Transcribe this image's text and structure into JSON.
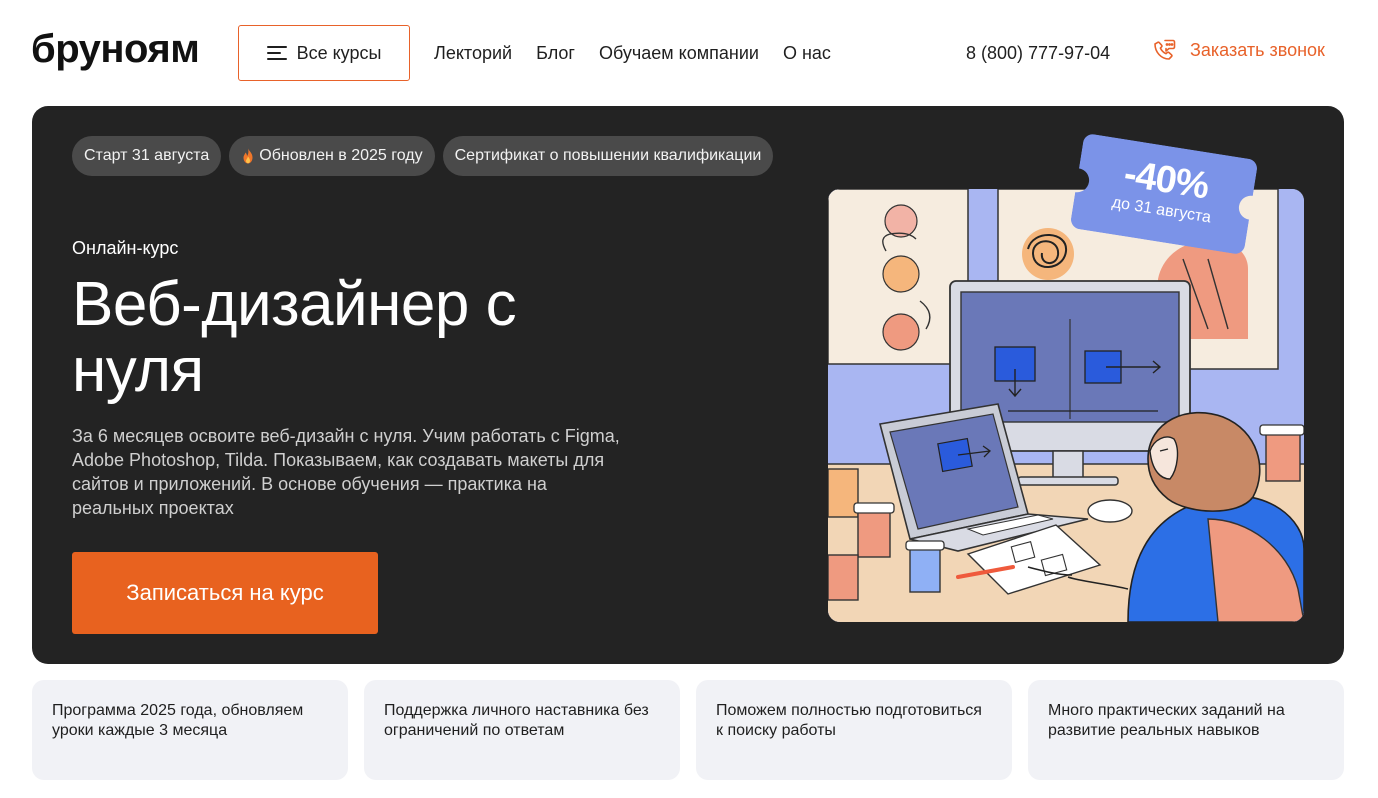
{
  "header": {
    "logo": "бруноям",
    "all_courses_label": "Все курсы",
    "nav": [
      "Лекторий",
      "Блог",
      "Обучаем компании",
      "О нас"
    ],
    "phone": "8 (800) 777-97-04",
    "callback_label": "Заказать звонок"
  },
  "hero": {
    "chips": [
      "Старт 31 августа",
      "Обновлен в 2025 году",
      "Сертификат о повышении квалификации"
    ],
    "kicker": "Онлайн-курс",
    "title": "Веб-дизайнер с нуля",
    "description": "За 6 месяцев освоите веб-дизайн с нуля. Учим работать с Figma, Adobe Photoshop, Tilda. Показываем, как создавать макеты для сайтов и приложений. В основе обучения — практика на реальных проектах",
    "cta_label": "Записаться на курс",
    "discount": {
      "value": "-40%",
      "until": "до 31 августа"
    }
  },
  "features": [
    "Программа 2025 года, обновляем уроки каждые 3 месяца",
    "Поддержка личного наставника без ограничений по ответам",
    "Поможем полностью подготовиться к поиску работы",
    "Много практических заданий на развитие реальных навыков"
  ],
  "colors": {
    "accent": "#e8622a",
    "hero_bg": "#232323",
    "chip_bg": "#4a4a4a",
    "ticket": "#7b93e8",
    "feature_bg": "#f1f2f6"
  },
  "icons": {
    "menu": "burger-menu-icon",
    "callback": "phone-chat-icon",
    "chip": "fire-icon"
  }
}
